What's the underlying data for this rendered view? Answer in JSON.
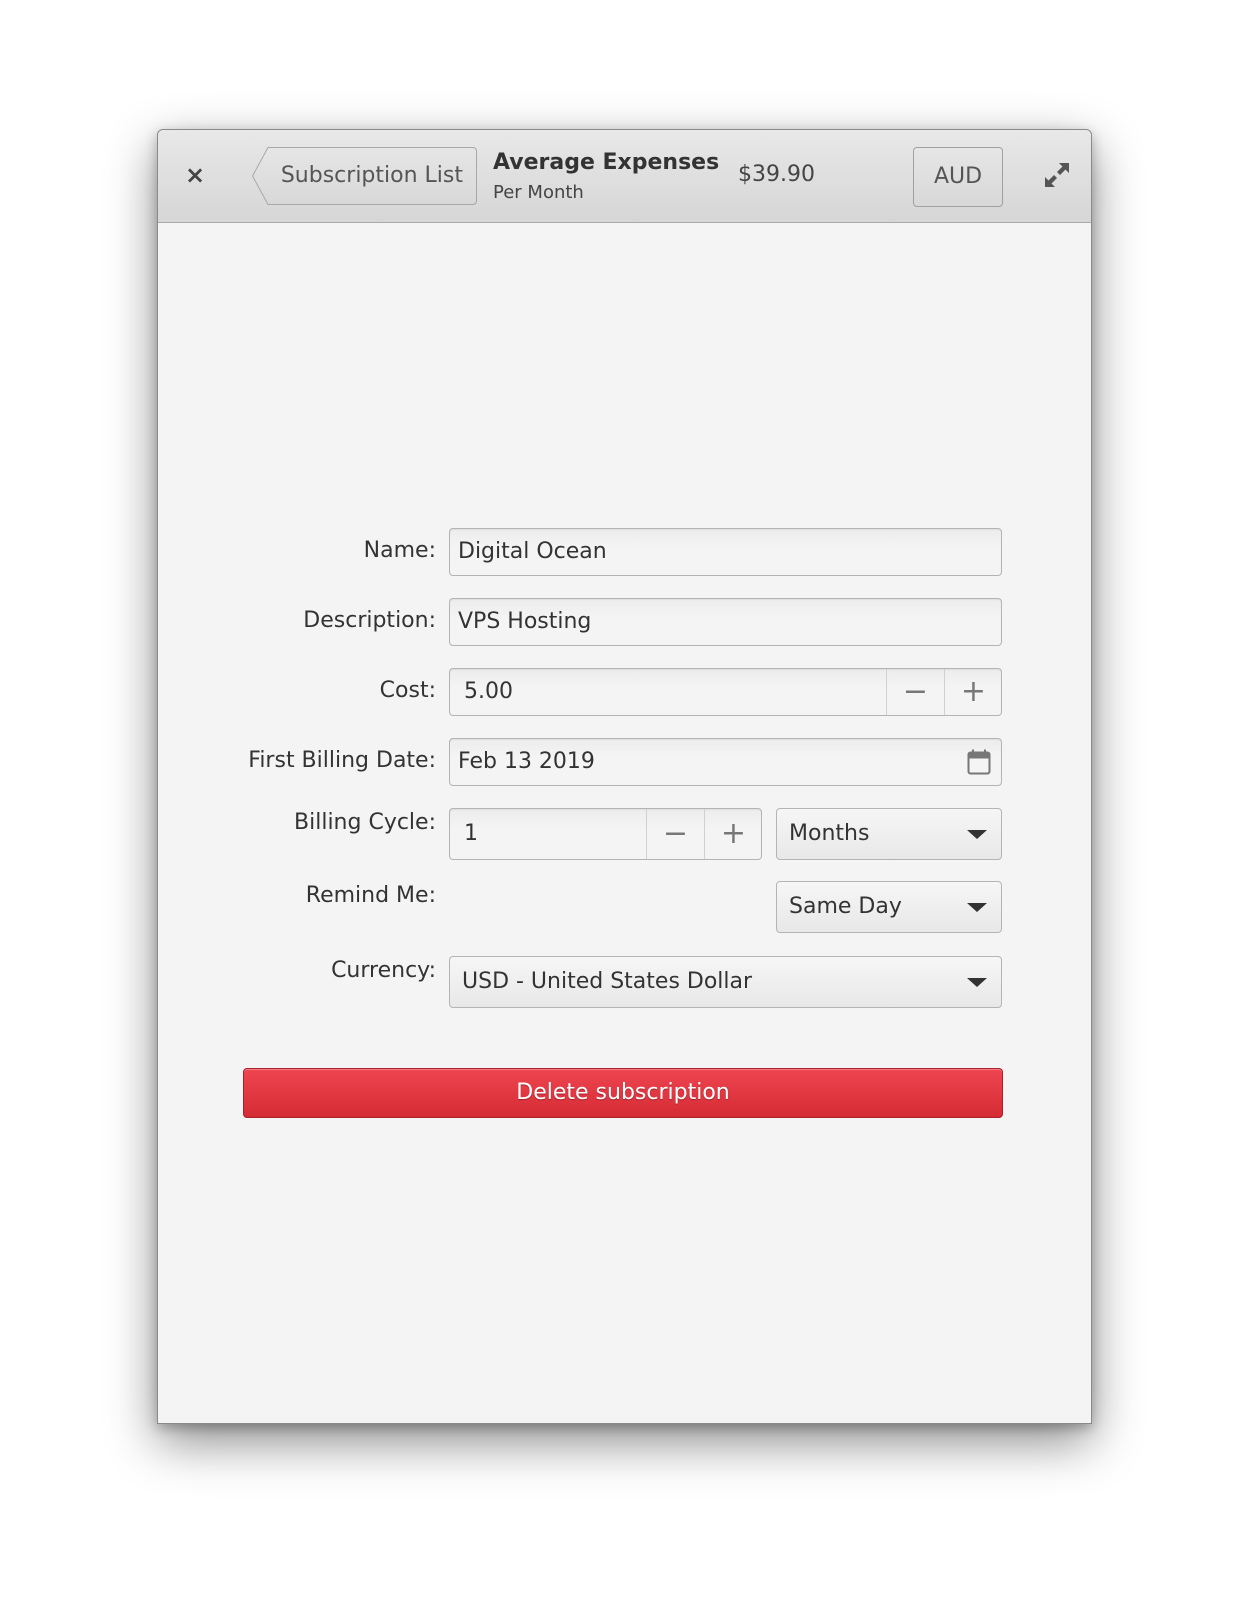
{
  "header": {
    "close_label": "×",
    "back_label": "Subscription List",
    "title": "Average Expenses",
    "subtitle": "Per Month",
    "amount": "$39.90",
    "currency_button": "AUD",
    "icons": {
      "close": "close-icon",
      "back": "back-arrow",
      "expand": "expand-icon"
    }
  },
  "form": {
    "name": {
      "label": "Name:",
      "value": "Digital Ocean"
    },
    "description": {
      "label": "Description:",
      "value": "VPS Hosting"
    },
    "cost": {
      "label": "Cost:",
      "value": "5.00",
      "minus": "−",
      "plus": "+"
    },
    "first_billing_date": {
      "label": "First Billing Date:",
      "value": "Feb 13 2019",
      "icon": "calendar-icon"
    },
    "billing_cycle": {
      "label": "Billing Cycle:",
      "value": "1",
      "minus": "−",
      "plus": "+",
      "unit": "Months"
    },
    "remind_me": {
      "label": "Remind Me:",
      "value": "Same Day"
    },
    "currency": {
      "label": "Currency:",
      "value": "USD - United States Dollar"
    }
  },
  "actions": {
    "delete_label": "Delete subscription"
  },
  "colors": {
    "danger": "#e0353f",
    "background": "#f4f4f4",
    "header": "#dcdcdc"
  }
}
